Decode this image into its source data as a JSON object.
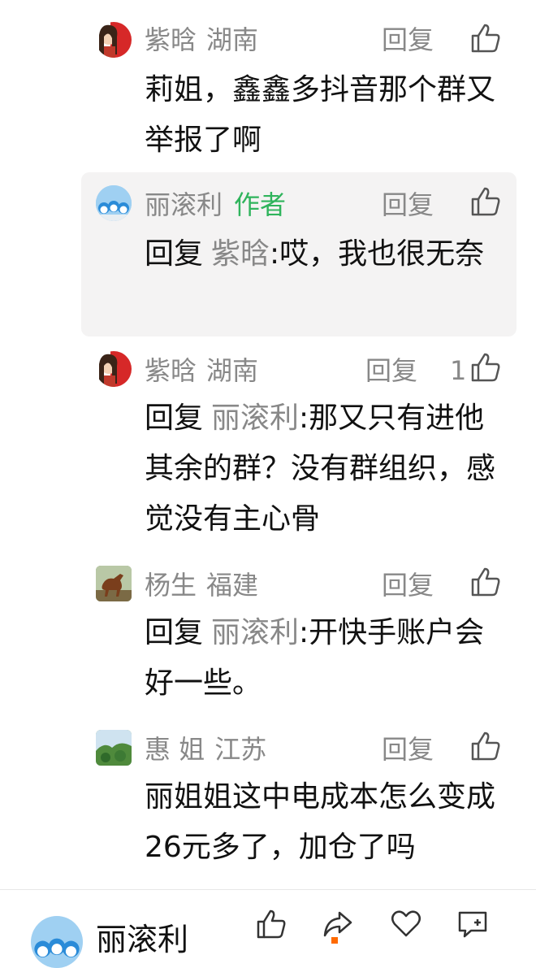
{
  "comments": [
    {
      "user": "紫晗",
      "loc": "湖南",
      "reply": "回复",
      "like_count": "",
      "body": "莉姐，鑫鑫多抖音那个群又举报了啊",
      "avatar_icon": "girl-red-dress-avatar-icon"
    },
    {
      "user": "丽滚利",
      "author_tag": "作者",
      "reply": "回复",
      "like_count": "",
      "reply_prefix": "回复",
      "reply_target": "紫晗",
      "body": ":哎，我也很无奈",
      "avatar_icon": "doraemon-avatar-icon"
    },
    {
      "user": "紫晗",
      "loc": "湖南",
      "reply": "回复",
      "like_count": "1",
      "reply_prefix": "回复",
      "reply_target": "丽滚利",
      "body": ":那又只有进他其余的群？没有群组织，感觉没有主心骨",
      "avatar_icon": "girl-red-dress-avatar-icon"
    },
    {
      "user": "杨生",
      "loc": "福建",
      "reply": "回复",
      "like_count": "",
      "reply_prefix": "回复",
      "reply_target": "丽滚利",
      "body": ":开快手账户会好一些。",
      "avatar_icon": "horse-avatar-icon"
    },
    {
      "user": "惠 姐",
      "loc": "江苏",
      "reply": "回复",
      "like_count": "",
      "body": "丽姐姐这中电成本怎么变成26元多了，加仓了吗",
      "avatar_icon": "landscape-avatar-icon"
    }
  ],
  "bottom_bar": {
    "name": "丽滚利",
    "icons": [
      "like-icon",
      "share-icon",
      "favorite-icon",
      "comment-add-icon"
    ]
  },
  "colors": {
    "author_tag": "#2fb45c",
    "muted": "#888888",
    "highlight_bg": "#f4f3f3"
  }
}
